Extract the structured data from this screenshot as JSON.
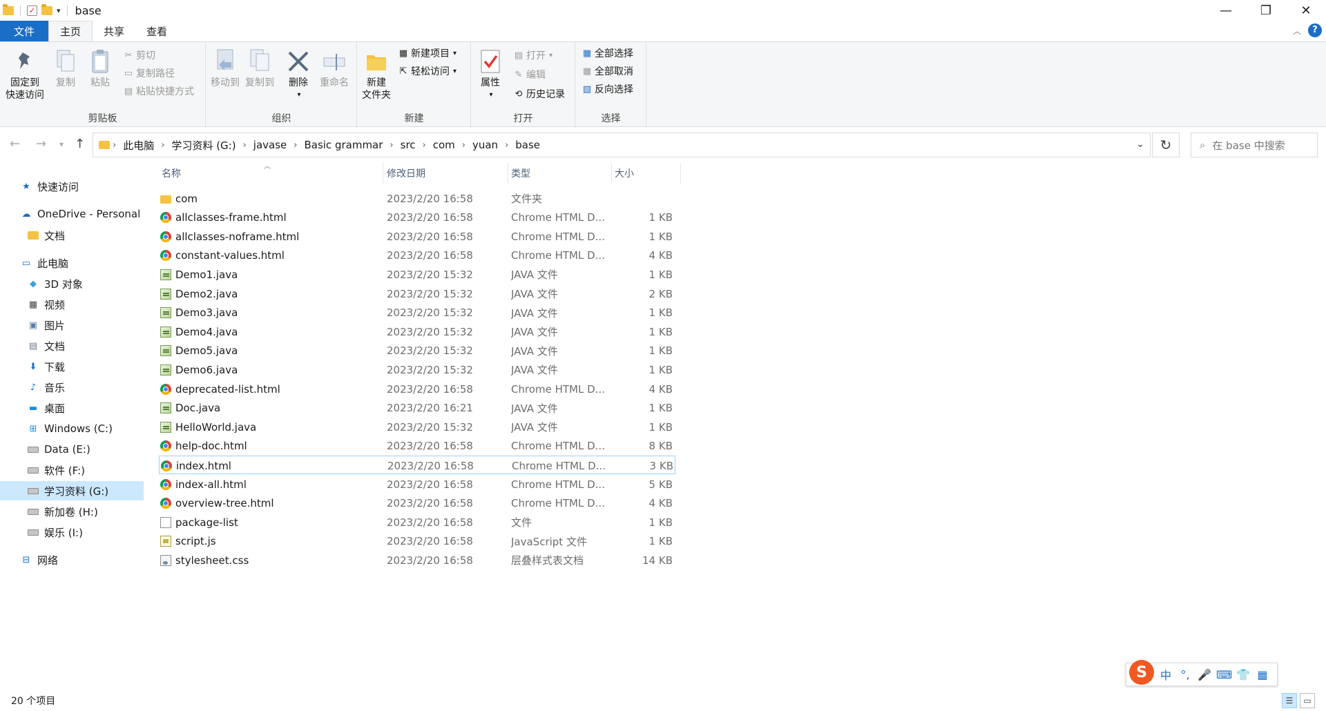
{
  "window": {
    "title": "base",
    "controls": {
      "minimize": "—",
      "restore": "❐",
      "close": "✕"
    }
  },
  "tabs": [
    "文件",
    "主页",
    "共享",
    "查看"
  ],
  "ribbon": {
    "clipboard": {
      "label": "剪贴板",
      "pin_line1": "固定到",
      "pin_line2": "快速访问",
      "copy": "复制",
      "paste": "粘贴",
      "cut": "剪切",
      "copy_path": "复制路径",
      "paste_shortcut": "粘贴快捷方式"
    },
    "organize": {
      "label": "组织",
      "move_to": "移动到",
      "copy_to": "复制到",
      "delete": "删除",
      "rename": "重命名"
    },
    "new": {
      "label": "新建",
      "new_folder_line1": "新建",
      "new_folder_line2": "文件夹",
      "new_item": "新建项目",
      "easy_access": "轻松访问"
    },
    "open": {
      "label": "打开",
      "properties": "属性",
      "open": "打开",
      "edit": "编辑",
      "history": "历史记录"
    },
    "select": {
      "label": "选择",
      "select_all": "全部选择",
      "select_none": "全部取消",
      "invert": "反向选择"
    }
  },
  "address": {
    "crumbs": [
      "此电脑",
      "学习资料 (G:)",
      "javase",
      "Basic grammar",
      "src",
      "com",
      "yuan",
      "base"
    ],
    "search_placeholder": "在 base 中搜索"
  },
  "nav": {
    "quick_access": "快速访问",
    "onedrive": "OneDrive - Personal",
    "onedrive_docs": "文档",
    "this_pc": "此电脑",
    "objects3d": "3D 对象",
    "videos": "视频",
    "pictures": "图片",
    "documents": "文档",
    "downloads": "下载",
    "music": "音乐",
    "desktop": "桌面",
    "drive_c": "Windows (C:)",
    "drive_e": "Data (E:)",
    "drive_f": "软件 (F:)",
    "drive_g": "学习资料 (G:)",
    "drive_h": "新加卷 (H:)",
    "drive_i": "娱乐 (I:)",
    "network": "网络"
  },
  "columns": {
    "name": "名称",
    "date": "修改日期",
    "type": "类型",
    "size": "大小"
  },
  "files": [
    {
      "name": "com",
      "date": "2023/2/20 16:58",
      "type": "文件夹",
      "size": "",
      "icon": "folder"
    },
    {
      "name": "allclasses-frame.html",
      "date": "2023/2/20 16:58",
      "type": "Chrome HTML D...",
      "size": "1 KB",
      "icon": "chrome"
    },
    {
      "name": "allclasses-noframe.html",
      "date": "2023/2/20 16:58",
      "type": "Chrome HTML D...",
      "size": "1 KB",
      "icon": "chrome"
    },
    {
      "name": "constant-values.html",
      "date": "2023/2/20 16:58",
      "type": "Chrome HTML D...",
      "size": "4 KB",
      "icon": "chrome"
    },
    {
      "name": "Demo1.java",
      "date": "2023/2/20 15:32",
      "type": "JAVA 文件",
      "size": "1 KB",
      "icon": "java"
    },
    {
      "name": "Demo2.java",
      "date": "2023/2/20 15:32",
      "type": "JAVA 文件",
      "size": "2 KB",
      "icon": "java"
    },
    {
      "name": "Demo3.java",
      "date": "2023/2/20 15:32",
      "type": "JAVA 文件",
      "size": "1 KB",
      "icon": "java"
    },
    {
      "name": "Demo4.java",
      "date": "2023/2/20 15:32",
      "type": "JAVA 文件",
      "size": "1 KB",
      "icon": "java"
    },
    {
      "name": "Demo5.java",
      "date": "2023/2/20 15:32",
      "type": "JAVA 文件",
      "size": "1 KB",
      "icon": "java"
    },
    {
      "name": "Demo6.java",
      "date": "2023/2/20 15:32",
      "type": "JAVA 文件",
      "size": "1 KB",
      "icon": "java"
    },
    {
      "name": "deprecated-list.html",
      "date": "2023/2/20 16:58",
      "type": "Chrome HTML D...",
      "size": "4 KB",
      "icon": "chrome"
    },
    {
      "name": "Doc.java",
      "date": "2023/2/20 16:21",
      "type": "JAVA 文件",
      "size": "1 KB",
      "icon": "java"
    },
    {
      "name": "HelloWorld.java",
      "date": "2023/2/20 15:32",
      "type": "JAVA 文件",
      "size": "1 KB",
      "icon": "java"
    },
    {
      "name": "help-doc.html",
      "date": "2023/2/20 16:58",
      "type": "Chrome HTML D...",
      "size": "8 KB",
      "icon": "chrome"
    },
    {
      "name": "index.html",
      "date": "2023/2/20 16:58",
      "type": "Chrome HTML D...",
      "size": "3 KB",
      "icon": "chrome",
      "selected": true
    },
    {
      "name": "index-all.html",
      "date": "2023/2/20 16:58",
      "type": "Chrome HTML D...",
      "size": "5 KB",
      "icon": "chrome"
    },
    {
      "name": "overview-tree.html",
      "date": "2023/2/20 16:58",
      "type": "Chrome HTML D...",
      "size": "4 KB",
      "icon": "chrome"
    },
    {
      "name": "package-list",
      "date": "2023/2/20 16:58",
      "type": "文件",
      "size": "1 KB",
      "icon": "file"
    },
    {
      "name": "script.js",
      "date": "2023/2/20 16:58",
      "type": "JavaScript 文件",
      "size": "1 KB",
      "icon": "js"
    },
    {
      "name": "stylesheet.css",
      "date": "2023/2/20 16:58",
      "type": "层叠样式表文档",
      "size": "14 KB",
      "icon": "css"
    }
  ],
  "status": {
    "count": "20 个项目"
  },
  "ime": {
    "logo": "S",
    "lang": "中",
    "punct": "°,",
    "mic": "🎤",
    "keyboard": "⌨",
    "skin": "👕",
    "tools": "▦"
  },
  "colors": {
    "accent": "#1a6ec6",
    "selection": "#cce8ff",
    "selection_border": "#99d1ff"
  }
}
